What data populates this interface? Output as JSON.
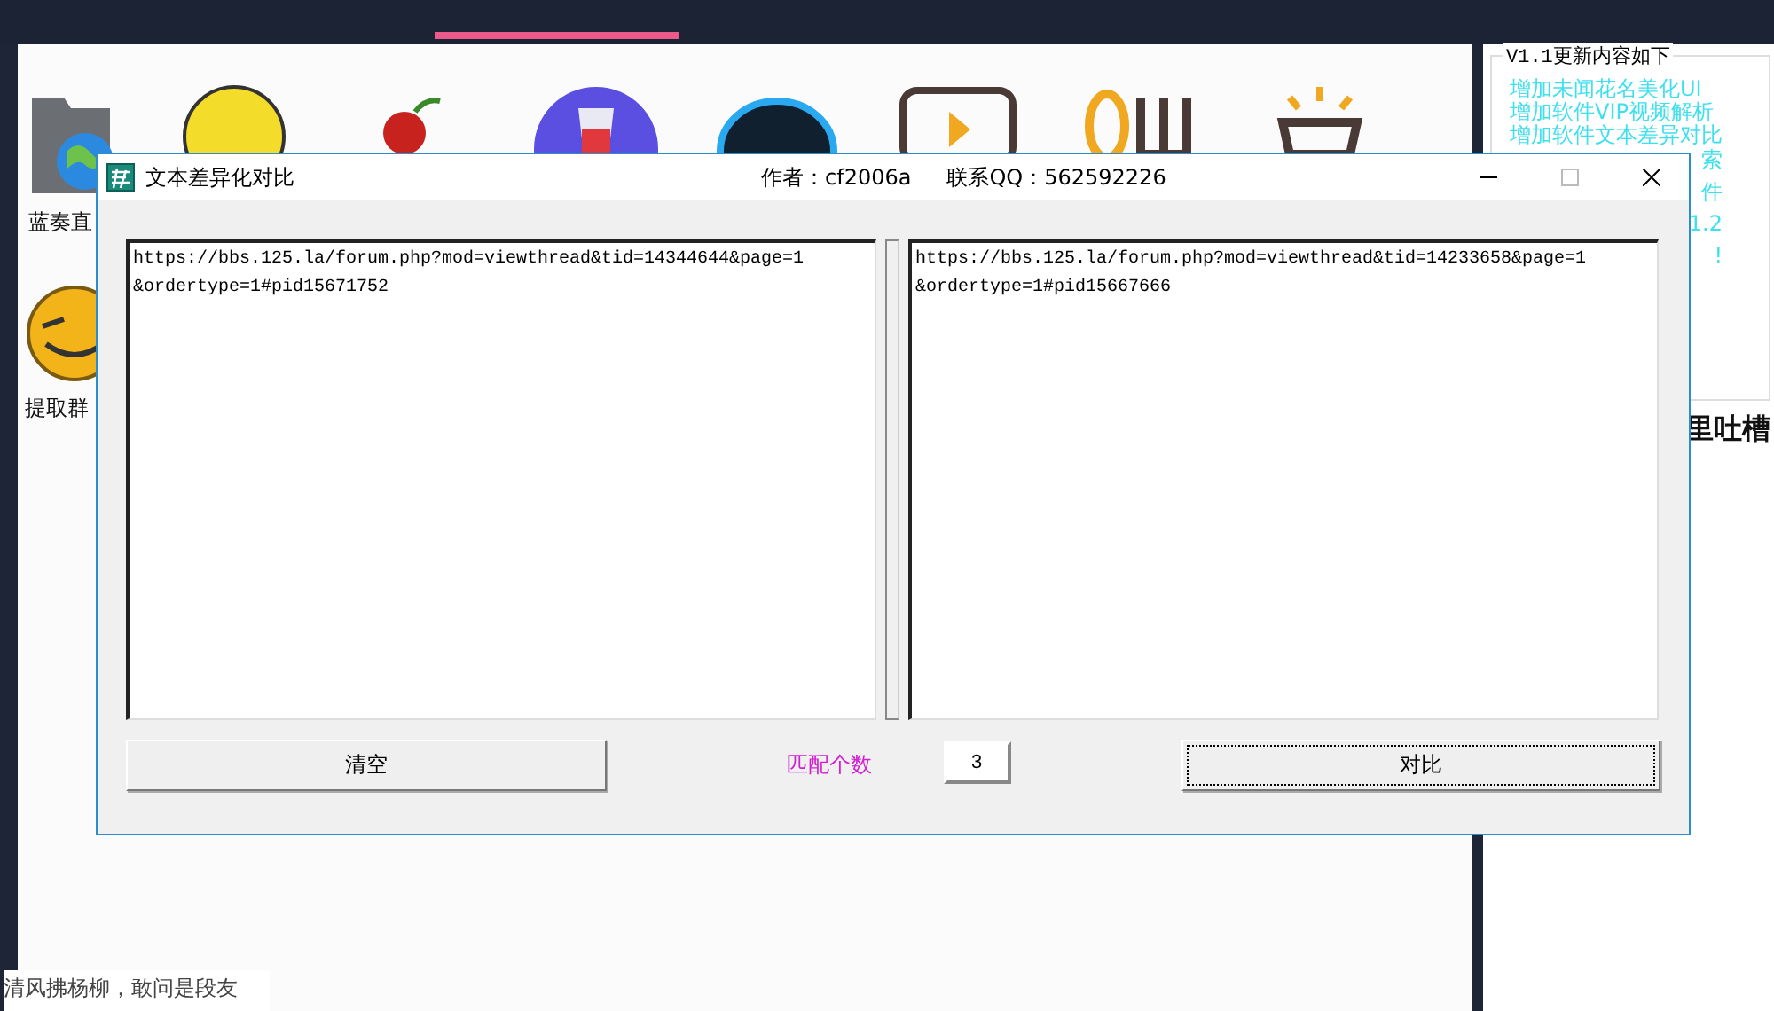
{
  "launcher": {
    "items": [
      {
        "label": "蓝奏直"
      },
      {
        "label": "提取群"
      }
    ]
  },
  "update_panel": {
    "title": "V1.1更新内容如下",
    "lines": [
      "增加未闻花名美化UI",
      "增加软件VIP视频解析",
      "增加软件文本差异对比"
    ],
    "fragments": [
      "索",
      "件",
      "1.2",
      "!"
    ]
  },
  "side_heading": "里吐槽",
  "footer_text": "清风拂杨柳，敢问是段友",
  "dialog": {
    "title": "文本差异化对比",
    "author": "作者：cf2006a",
    "contact": "联系QQ：562592226",
    "left_lines": [
      "https://bbs.125.la/forum.php?mod=viewthread&tid=14344644&page=1",
      "&ordertype=1#pid15671752"
    ],
    "right_lines": [
      "https://bbs.125.la/forum.php?mod=viewthread&tid=14233658&page=1",
      "&ordertype=1#pid15667666"
    ],
    "clear_button": "清空",
    "match_label": "匹配个数",
    "match_count": "3",
    "compare_button": {
      "label": "对比",
      "focused": true
    }
  }
}
